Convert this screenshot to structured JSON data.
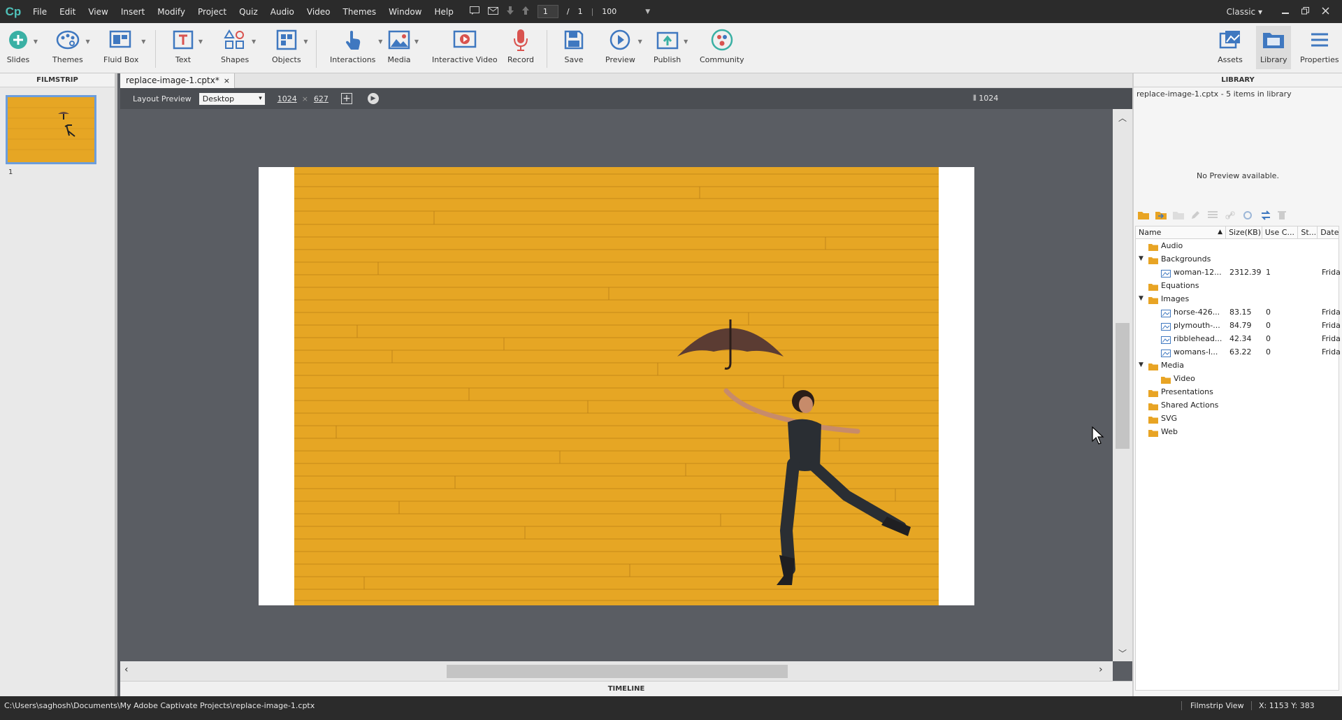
{
  "app": {
    "logo": "Cp",
    "menu": [
      "File",
      "Edit",
      "View",
      "Insert",
      "Modify",
      "Project",
      "Quiz",
      "Audio",
      "Video",
      "Themes",
      "Window",
      "Help"
    ],
    "slide_current": "1",
    "slide_sep": "/",
    "slide_total": "1",
    "zoom": "100",
    "workspace": "Classic"
  },
  "toolbar": {
    "slides": "Slides",
    "themes": "Themes",
    "fluid_box": "Fluid Box",
    "text": "Text",
    "shapes": "Shapes",
    "objects": "Objects",
    "interactions": "Interactions",
    "media": "Media",
    "interactive_video": "Interactive Video",
    "record": "Record",
    "save": "Save",
    "preview": "Preview",
    "publish": "Publish",
    "community": "Community",
    "assets": "Assets",
    "library": "Library",
    "properties": "Properties"
  },
  "filmstrip": {
    "header": "FILMSTRIP",
    "slide_number": "1"
  },
  "document": {
    "tab_title": "replace-image-1.cptx*",
    "close": "×"
  },
  "layout_preview": {
    "label": "Layout Preview",
    "device": "Desktop",
    "width": "1024",
    "times": "×",
    "height": "627",
    "ruler_value": "1024"
  },
  "timeline": {
    "label": "TIMELINE"
  },
  "library": {
    "header": "LIBRARY",
    "info": "replace-image-1.cptx - 5 items in library",
    "no_preview": "No Preview available.",
    "columns": [
      "Name",
      "Size(KB)",
      "Use C...",
      "St...",
      "Date"
    ],
    "tree": [
      {
        "name": "Audio",
        "level": 0,
        "expanded": false,
        "folder": true
      },
      {
        "name": "Backgrounds",
        "level": 0,
        "expanded": true,
        "folder": true
      },
      {
        "name": "woman-12...",
        "level": 1,
        "size": "2312.39",
        "use": "1",
        "date": "Frida"
      },
      {
        "name": "Equations",
        "level": 0,
        "expanded": false,
        "folder": true
      },
      {
        "name": "Images",
        "level": 0,
        "expanded": true,
        "folder": true
      },
      {
        "name": "horse-426...",
        "level": 1,
        "size": "83.15",
        "use": "0",
        "date": "Frida"
      },
      {
        "name": "plymouth-...",
        "level": 1,
        "size": "84.79",
        "use": "0",
        "date": "Frida"
      },
      {
        "name": "ribblehead...",
        "level": 1,
        "size": "42.34",
        "use": "0",
        "date": "Frida"
      },
      {
        "name": "womans-l...",
        "level": 1,
        "size": "63.22",
        "use": "0",
        "date": "Frida"
      },
      {
        "name": "Media",
        "level": 0,
        "expanded": true,
        "folder": true
      },
      {
        "name": "Video",
        "level": 1,
        "folder": true
      },
      {
        "name": "Presentations",
        "level": 0,
        "folder": true
      },
      {
        "name": "Shared Actions",
        "level": 0,
        "folder": true
      },
      {
        "name": "SVG",
        "level": 0,
        "folder": true
      },
      {
        "name": "Web",
        "level": 0,
        "folder": true
      }
    ]
  },
  "status": {
    "path": "C:\\Users\\saghosh\\Documents\\My Adobe Captivate Projects\\replace-image-1.cptx",
    "view": "Filmstrip View",
    "coords": "X: 1153 Y: 383"
  },
  "colors": {
    "accent": "#4fc1b9",
    "wall": "#e6a624",
    "selection": "#6c9ddc",
    "record": "#d9534f"
  }
}
